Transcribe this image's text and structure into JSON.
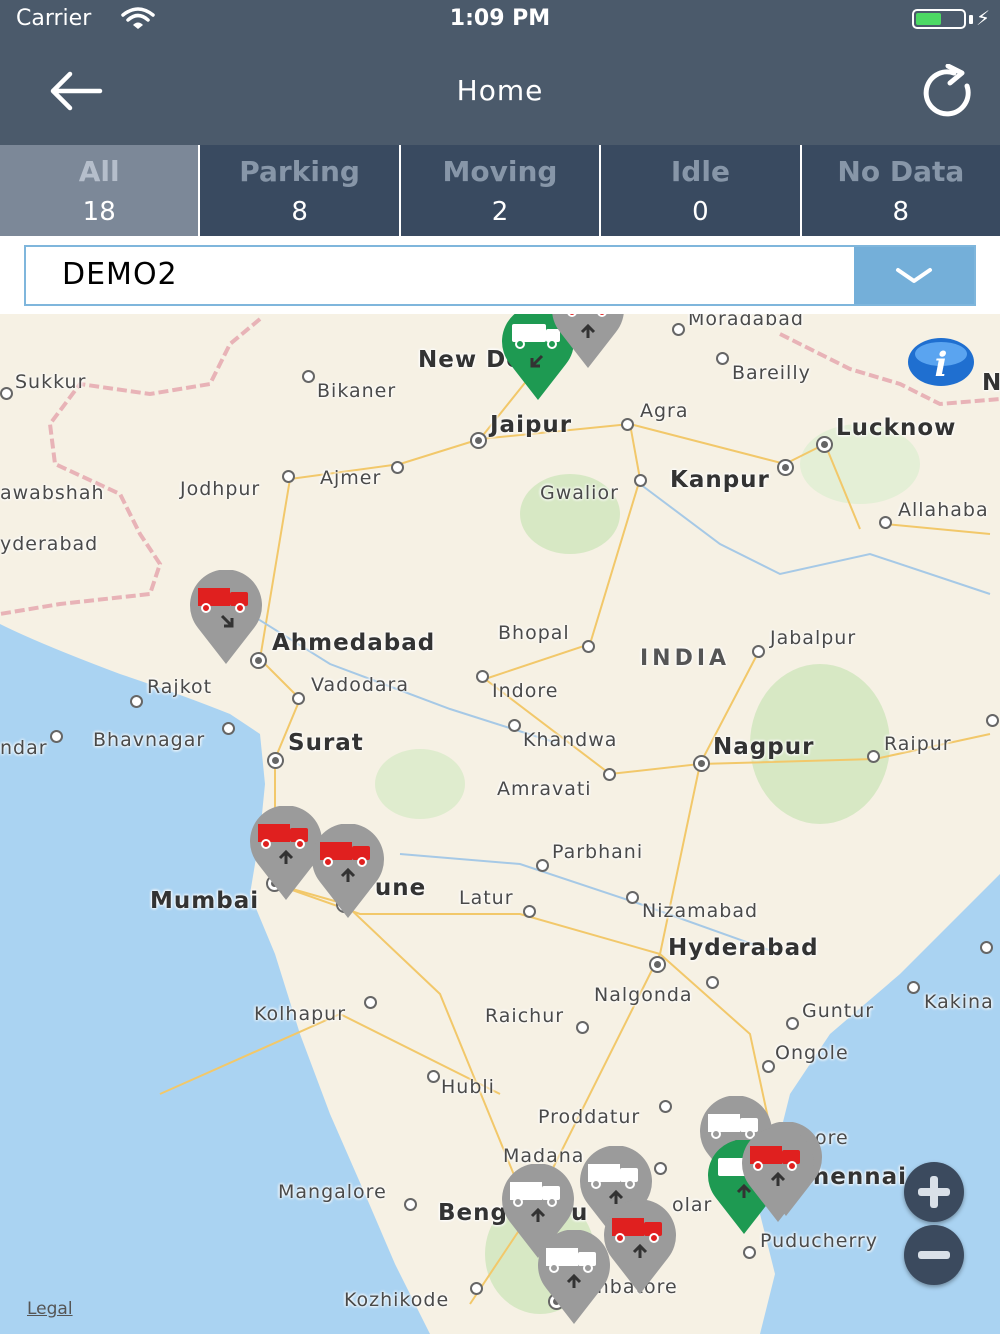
{
  "status": {
    "carrier": "Carrier",
    "time": "1:09 PM"
  },
  "nav": {
    "title": "Home"
  },
  "tabs": [
    {
      "label": "All",
      "count": "18"
    },
    {
      "label": "Parking",
      "count": "8"
    },
    {
      "label": "Moving",
      "count": "2"
    },
    {
      "label": "Idle",
      "count": "0"
    },
    {
      "label": "No Data",
      "count": "8"
    }
  ],
  "vehicle_select": {
    "value": "DEMO2"
  },
  "map": {
    "legal": "Legal",
    "country": "INDIA",
    "cities": [
      "Moradabad",
      "New Delhi",
      "Sukkur",
      "Bikaner",
      "Bareilly",
      "Jaipur",
      "Agra",
      "Lucknow",
      "awabshah",
      "Jodhpur",
      "Ajmer",
      "Gwalior",
      "Kanpur",
      "Allahaba",
      "yderabad",
      "Ahmedabad",
      "Bhopal",
      "Jabalpur",
      "Rajkot",
      "Vadodara",
      "Indore",
      "ndar",
      "Bhavnagar",
      "Khandwa",
      "Surat",
      "Nagpur",
      "Raipur",
      "Amravati",
      "Parbhani",
      "Mumbai",
      "Pune",
      "Latur",
      "Nizamabad",
      "Hyderabad",
      "Nalgonda",
      "Kakina",
      "Kolhapur",
      "Raichur",
      "Guntur",
      "Ongole",
      "Hubli",
      "Proddatur",
      "ore",
      "Madana",
      "Chennai",
      "Mangalore",
      "Beng",
      "u",
      "olar",
      "Puducherry",
      "Kozhikode",
      "imbatore",
      "N"
    ],
    "markers": [
      {
        "type": "moving",
        "label": "moving-truck-new-delhi"
      },
      {
        "type": "parking",
        "label": "parking-truck-new-delhi"
      },
      {
        "type": "parking",
        "label": "parking-truck-gujarat"
      },
      {
        "type": "parking",
        "label": "parking-truck-mumbai"
      },
      {
        "type": "parking",
        "label": "parking-truck-pune"
      },
      {
        "type": "nodata",
        "label": "nodata-truck-chennai-1"
      },
      {
        "type": "nodata",
        "label": "nodata-truck-chennai-2"
      },
      {
        "type": "parking",
        "label": "parking-truck-chennai"
      },
      {
        "type": "moving",
        "label": "moving-truck-chennai"
      },
      {
        "type": "nodata",
        "label": "nodata-truck-bengaluru-1"
      },
      {
        "type": "nodata",
        "label": "nodata-truck-madanapalle"
      },
      {
        "type": "parking",
        "label": "parking-truck-krishnagiri"
      },
      {
        "type": "nodata",
        "label": "nodata-truck-bengaluru-2"
      }
    ]
  },
  "colors": {
    "navbar": "#4b5a6b",
    "tabs": "#394a60",
    "tab_active": "#7c8898",
    "accent": "#74afd9",
    "parking": "#e0201f",
    "moving": "#1e9a52",
    "nodata_pin": "#9b9b9b"
  }
}
